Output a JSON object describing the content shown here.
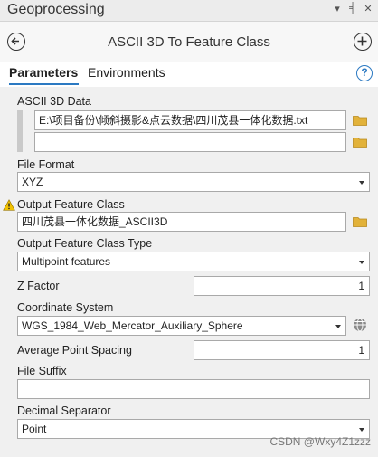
{
  "window": {
    "title": "Geoprocessing",
    "controls": [
      "▾",
      "╡",
      "✕"
    ]
  },
  "header": {
    "title": "ASCII 3D To Feature Class"
  },
  "tabs": [
    {
      "label": "Parameters"
    },
    {
      "label": "Environments"
    }
  ],
  "help": {
    "symbol": "?"
  },
  "params": {
    "ascii_data": {
      "label": "ASCII 3D Data",
      "value": "E:\\项目备份\\倾斜摄影&点云数据\\四川茂县一体化数据.txt",
      "second_value": ""
    },
    "file_format": {
      "label": "File Format",
      "value": "XYZ"
    },
    "output_fc": {
      "label": "Output Feature Class",
      "value": "四川茂县一体化数据_ASCII3D"
    },
    "output_type": {
      "label": "Output Feature Class Type",
      "value": "Multipoint features"
    },
    "z_factor": {
      "label": "Z Factor",
      "value": "1"
    },
    "coord_sys": {
      "label": "Coordinate System",
      "value": "WGS_1984_Web_Mercator_Auxiliary_Sphere"
    },
    "avg_spacing": {
      "label": "Average Point Spacing",
      "value": "1"
    },
    "file_suffix": {
      "label": "File Suffix",
      "value": ""
    },
    "decimal_sep": {
      "label": "Decimal Separator",
      "value": "Point"
    }
  },
  "watermark": "CSDN @Wxy4Z1zzz",
  "colors": {
    "accent": "#2b79c2",
    "folder": "#e2b23a",
    "warning": "#f2c200"
  }
}
